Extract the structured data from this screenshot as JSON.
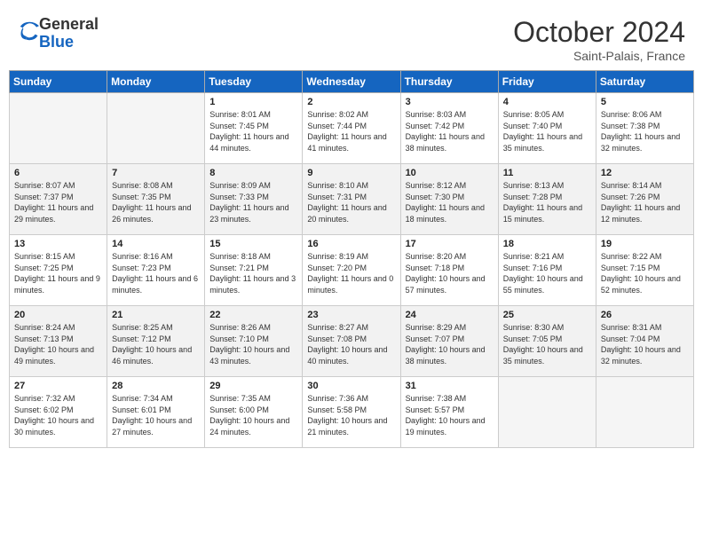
{
  "header": {
    "logo_general": "General",
    "logo_blue": "Blue",
    "month_year": "October 2024",
    "location": "Saint-Palais, France"
  },
  "days_of_week": [
    "Sunday",
    "Monday",
    "Tuesday",
    "Wednesday",
    "Thursday",
    "Friday",
    "Saturday"
  ],
  "weeks": [
    {
      "shaded": false,
      "days": [
        {
          "num": "",
          "info": ""
        },
        {
          "num": "",
          "info": ""
        },
        {
          "num": "1",
          "info": "Sunrise: 8:01 AM\nSunset: 7:45 PM\nDaylight: 11 hours and 44 minutes."
        },
        {
          "num": "2",
          "info": "Sunrise: 8:02 AM\nSunset: 7:44 PM\nDaylight: 11 hours and 41 minutes."
        },
        {
          "num": "3",
          "info": "Sunrise: 8:03 AM\nSunset: 7:42 PM\nDaylight: 11 hours and 38 minutes."
        },
        {
          "num": "4",
          "info": "Sunrise: 8:05 AM\nSunset: 7:40 PM\nDaylight: 11 hours and 35 minutes."
        },
        {
          "num": "5",
          "info": "Sunrise: 8:06 AM\nSunset: 7:38 PM\nDaylight: 11 hours and 32 minutes."
        }
      ]
    },
    {
      "shaded": true,
      "days": [
        {
          "num": "6",
          "info": "Sunrise: 8:07 AM\nSunset: 7:37 PM\nDaylight: 11 hours and 29 minutes."
        },
        {
          "num": "7",
          "info": "Sunrise: 8:08 AM\nSunset: 7:35 PM\nDaylight: 11 hours and 26 minutes."
        },
        {
          "num": "8",
          "info": "Sunrise: 8:09 AM\nSunset: 7:33 PM\nDaylight: 11 hours and 23 minutes."
        },
        {
          "num": "9",
          "info": "Sunrise: 8:10 AM\nSunset: 7:31 PM\nDaylight: 11 hours and 20 minutes."
        },
        {
          "num": "10",
          "info": "Sunrise: 8:12 AM\nSunset: 7:30 PM\nDaylight: 11 hours and 18 minutes."
        },
        {
          "num": "11",
          "info": "Sunrise: 8:13 AM\nSunset: 7:28 PM\nDaylight: 11 hours and 15 minutes."
        },
        {
          "num": "12",
          "info": "Sunrise: 8:14 AM\nSunset: 7:26 PM\nDaylight: 11 hours and 12 minutes."
        }
      ]
    },
    {
      "shaded": false,
      "days": [
        {
          "num": "13",
          "info": "Sunrise: 8:15 AM\nSunset: 7:25 PM\nDaylight: 11 hours and 9 minutes."
        },
        {
          "num": "14",
          "info": "Sunrise: 8:16 AM\nSunset: 7:23 PM\nDaylight: 11 hours and 6 minutes."
        },
        {
          "num": "15",
          "info": "Sunrise: 8:18 AM\nSunset: 7:21 PM\nDaylight: 11 hours and 3 minutes."
        },
        {
          "num": "16",
          "info": "Sunrise: 8:19 AM\nSunset: 7:20 PM\nDaylight: 11 hours and 0 minutes."
        },
        {
          "num": "17",
          "info": "Sunrise: 8:20 AM\nSunset: 7:18 PM\nDaylight: 10 hours and 57 minutes."
        },
        {
          "num": "18",
          "info": "Sunrise: 8:21 AM\nSunset: 7:16 PM\nDaylight: 10 hours and 55 minutes."
        },
        {
          "num": "19",
          "info": "Sunrise: 8:22 AM\nSunset: 7:15 PM\nDaylight: 10 hours and 52 minutes."
        }
      ]
    },
    {
      "shaded": true,
      "days": [
        {
          "num": "20",
          "info": "Sunrise: 8:24 AM\nSunset: 7:13 PM\nDaylight: 10 hours and 49 minutes."
        },
        {
          "num": "21",
          "info": "Sunrise: 8:25 AM\nSunset: 7:12 PM\nDaylight: 10 hours and 46 minutes."
        },
        {
          "num": "22",
          "info": "Sunrise: 8:26 AM\nSunset: 7:10 PM\nDaylight: 10 hours and 43 minutes."
        },
        {
          "num": "23",
          "info": "Sunrise: 8:27 AM\nSunset: 7:08 PM\nDaylight: 10 hours and 40 minutes."
        },
        {
          "num": "24",
          "info": "Sunrise: 8:29 AM\nSunset: 7:07 PM\nDaylight: 10 hours and 38 minutes."
        },
        {
          "num": "25",
          "info": "Sunrise: 8:30 AM\nSunset: 7:05 PM\nDaylight: 10 hours and 35 minutes."
        },
        {
          "num": "26",
          "info": "Sunrise: 8:31 AM\nSunset: 7:04 PM\nDaylight: 10 hours and 32 minutes."
        }
      ]
    },
    {
      "shaded": false,
      "days": [
        {
          "num": "27",
          "info": "Sunrise: 7:32 AM\nSunset: 6:02 PM\nDaylight: 10 hours and 30 minutes."
        },
        {
          "num": "28",
          "info": "Sunrise: 7:34 AM\nSunset: 6:01 PM\nDaylight: 10 hours and 27 minutes."
        },
        {
          "num": "29",
          "info": "Sunrise: 7:35 AM\nSunset: 6:00 PM\nDaylight: 10 hours and 24 minutes."
        },
        {
          "num": "30",
          "info": "Sunrise: 7:36 AM\nSunset: 5:58 PM\nDaylight: 10 hours and 21 minutes."
        },
        {
          "num": "31",
          "info": "Sunrise: 7:38 AM\nSunset: 5:57 PM\nDaylight: 10 hours and 19 minutes."
        },
        {
          "num": "",
          "info": ""
        },
        {
          "num": "",
          "info": ""
        }
      ]
    }
  ]
}
